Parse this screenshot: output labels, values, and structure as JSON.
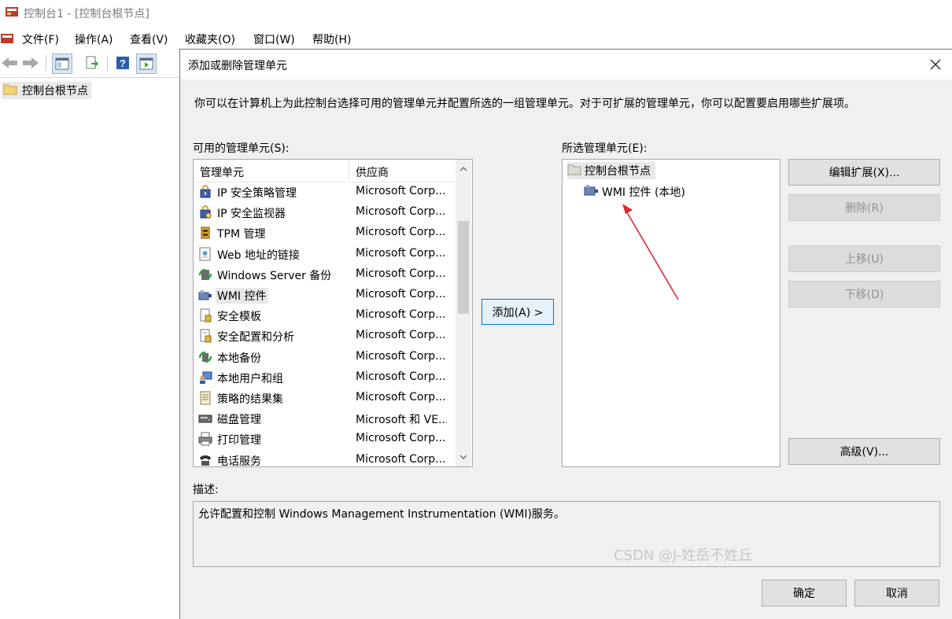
{
  "window": {
    "title": "控制台1 - [控制台根节点]"
  },
  "menu": [
    "文件(F)",
    "操作(A)",
    "查看(V)",
    "收藏夹(O)",
    "窗口(W)",
    "帮助(H)"
  ],
  "tree": {
    "root": "控制台根节点"
  },
  "dialog": {
    "title": "添加或删除管理单元",
    "intro": "你可以在计算机上为此控制台选择可用的管理单元并配置所选的一组管理单元。对于可扩展的管理单元，你可以配置要启用哪些扩展项。",
    "available_label": "可用的管理单元(S):",
    "columns": {
      "name": "管理单元",
      "vendor": "供应商"
    },
    "available": [
      {
        "name": "IP 安全策略管理",
        "vendor": "Microsoft Corp...",
        "icon": "ip-security-policy-icon"
      },
      {
        "name": "IP 安全监视器",
        "vendor": "Microsoft Corp...",
        "icon": "ip-security-monitor-icon"
      },
      {
        "name": "TPM 管理",
        "vendor": "Microsoft Corp...",
        "icon": "tpm-icon"
      },
      {
        "name": "Web 地址的链接",
        "vendor": "Microsoft Corp...",
        "icon": "web-link-icon"
      },
      {
        "name": "Windows Server 备份",
        "vendor": "Microsoft Corp...",
        "icon": "server-backup-icon"
      },
      {
        "name": "WMI 控件",
        "vendor": "Microsoft Corp...",
        "icon": "wmi-icon",
        "selected": true
      },
      {
        "name": "安全模板",
        "vendor": "Microsoft Corp...",
        "icon": "security-template-icon"
      },
      {
        "name": "安全配置和分析",
        "vendor": "Microsoft Corp...",
        "icon": "security-config-icon"
      },
      {
        "name": "本地备份",
        "vendor": "Microsoft Corp...",
        "icon": "local-backup-icon"
      },
      {
        "name": "本地用户和组",
        "vendor": "Microsoft Corp...",
        "icon": "users-groups-icon"
      },
      {
        "name": "策略的结果集",
        "vendor": "Microsoft Corp...",
        "icon": "rsop-icon"
      },
      {
        "name": "磁盘管理",
        "vendor": "Microsoft 和 VE...",
        "icon": "disk-management-icon"
      },
      {
        "name": "打印管理",
        "vendor": "Microsoft Corp...",
        "icon": "print-management-icon"
      },
      {
        "name": "电话服务",
        "vendor": "Microsoft Corp...",
        "icon": "telephony-icon"
      }
    ],
    "add_button": "添加(A) >",
    "selected_label": "所选管理单元(E):",
    "selected_root": "控制台根节点",
    "selected_child": "WMI 控件 (本地)",
    "buttons": {
      "edit_extensions": "编辑扩展(X)...",
      "remove": "删除(R)",
      "move_up": "上移(U)",
      "move_down": "下移(D)",
      "advanced": "高级(V)..."
    },
    "desc_label": "描述:",
    "description": "允许配置和控制 Windows Management Instrumentation (WMI)服务。",
    "ok": "确定",
    "cancel": "取消"
  },
  "watermark": "CSDN @J-姓岳不姓丘",
  "colors": {
    "accent": "#0078d7",
    "arrow": "#e0262c",
    "dialog_bg": "#f0f0f0"
  }
}
